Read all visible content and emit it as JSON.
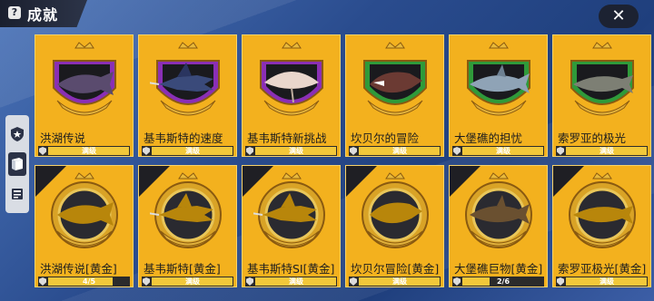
{
  "header": {
    "title": "成就",
    "help_icon": "question-icon",
    "close_icon": "close-icon",
    "close_glyph": "✕",
    "help_glyph": "?"
  },
  "side_tabs": [
    {
      "icon": "shield-star-icon",
      "active": false
    },
    {
      "icon": "book-icon",
      "active": true
    },
    {
      "icon": "card-icon",
      "active": false
    }
  ],
  "achievements": [
    {
      "name": "洪湖传说",
      "progress_text": "满级",
      "progress": 1.0,
      "fish": "arowana",
      "badge": "gold-purple",
      "row": 1
    },
    {
      "name": "基韦斯特的速度",
      "progress_text": "满级",
      "progress": 1.0,
      "fish": "marlin",
      "badge": "gold-purple",
      "row": 1
    },
    {
      "name": "基韦斯特新挑战",
      "progress_text": "满级",
      "progress": 1.0,
      "fish": "manta-ray",
      "badge": "gold-purple",
      "row": 1
    },
    {
      "name": "坎贝尔的冒险",
      "progress_text": "满级",
      "progress": 1.0,
      "fish": "monster-fish",
      "badge": "gold-green",
      "row": 1
    },
    {
      "name": "大堡礁的担忧",
      "progress_text": "满级",
      "progress": 1.0,
      "fish": "shark",
      "badge": "gold-green",
      "row": 1
    },
    {
      "name": "索罗亚的极光",
      "progress_text": "满级",
      "progress": 1.0,
      "fish": "greenland-shark",
      "badge": "gold-green",
      "row": 1
    },
    {
      "name": "洪湖传说[黄金]",
      "progress_text": "4/5",
      "progress": 0.8,
      "fish": "arowana",
      "badge": "golden",
      "row": 2
    },
    {
      "name": "基韦斯特[黄金]",
      "progress_text": "满级",
      "progress": 1.0,
      "fish": "marlin",
      "badge": "golden",
      "row": 2
    },
    {
      "name": "基韦斯特SI[黄金]",
      "progress_text": "满级",
      "progress": 1.0,
      "fish": "marlin",
      "badge": "golden",
      "row": 2
    },
    {
      "name": "坎贝尔冒险[黄金]",
      "progress_text": "满级",
      "progress": 1.0,
      "fish": "monster-fish",
      "badge": "golden",
      "row": 2
    },
    {
      "name": "大堡礁巨物[黄金]",
      "progress_text": "2/6",
      "progress": 0.333,
      "fish": "shark",
      "badge": "bronze",
      "row": 2
    },
    {
      "name": "索罗亚极光[黄金]",
      "progress_text": "满级",
      "progress": 1.0,
      "fish": "greenland-shark",
      "badge": "golden",
      "row": 2
    }
  ],
  "colors": {
    "card": "#f3b11e",
    "progress_fill": "#f2c83a",
    "progress_bg": "#2b2b2b",
    "badge_gold": "#d9a326",
    "badge_purple": "#8a2fb5",
    "badge_green": "#2f9a3a",
    "badge_bronze": "#8a6a3e"
  }
}
